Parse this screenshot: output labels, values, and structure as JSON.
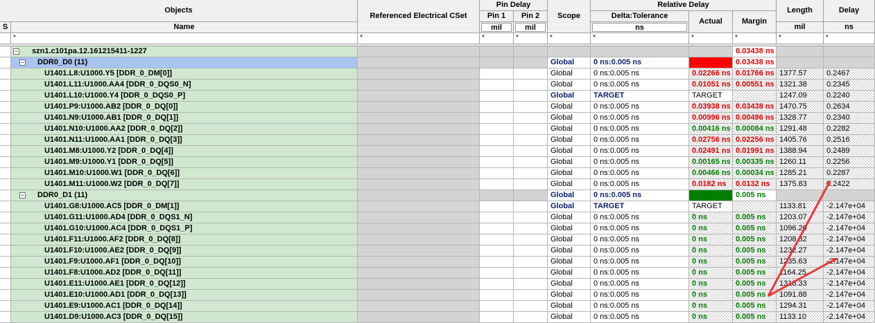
{
  "header": {
    "objects": "Objects",
    "name": "Name",
    "s": "S",
    "ref_cset": "Referenced Electrical CSet",
    "pin_delay": "Pin Delay",
    "pin1": "Pin 1",
    "pin2": "Pin 2",
    "pin_unit": "mil",
    "scope": "Scope",
    "relative_delay": "Relative Delay",
    "delta_tol": "Delta:Tolerance",
    "delta_unit": "ns",
    "actual": "Actual",
    "margin": "Margin",
    "length": "Length",
    "length_unit": "mil",
    "delay": "Delay",
    "delay_unit": "ns",
    "filter": "*"
  },
  "root": {
    "name": "szn1.c101pa.12.161215411-1227",
    "margin": "0.03438 ns",
    "toggle": "−"
  },
  "groups": [
    {
      "name": "DDR0_D0 (11)",
      "scope": "Global",
      "delta": "0 ns:0.005 ns",
      "actual_color": "#ff0000",
      "margin": "0.03438 ns",
      "margin_class": "red",
      "toggle": "−"
    },
    {
      "name": "DDR0_D1 (11)",
      "scope": "Global",
      "delta": "0 ns:0.005 ns",
      "actual_color": "#008000",
      "margin": "0.005 ns",
      "margin_class": "grn",
      "toggle": "−"
    }
  ],
  "rows_d0": [
    {
      "name": "U1401.L8:U1000.Y5 [DDR_0_DM[0]]",
      "scope": "Global",
      "delta": "0 ns:0.005 ns",
      "actual": "0.02266 ns",
      "actual_class": "red",
      "margin": "0.01766 ns",
      "margin_class": "red",
      "length": "1377.57",
      "delay": "0.2467"
    },
    {
      "name": "U1401.L11:U1000.AA4 [DDR_0_DQS0_N]",
      "scope": "Global",
      "delta": "0 ns:0.005 ns",
      "actual": "0.01051 ns",
      "actual_class": "red",
      "margin": "0.00551 ns",
      "margin_class": "red",
      "length": "1321.38",
      "delay": "0.2345"
    },
    {
      "name": "U1401.L10:U1000.Y4 [DDR_0_DQS0_P]",
      "scope": "Global",
      "delta": "TARGET",
      "actual": "TARGET",
      "actual_class": "",
      "margin": "",
      "margin_class": "",
      "length": "1247.09",
      "delay": "0.2240",
      "target": true
    },
    {
      "name": "U1401.P9:U1000.AB2 [DDR_0_DQ[0]]",
      "scope": "Global",
      "delta": "0 ns:0.005 ns",
      "actual": "0.03938 ns",
      "actual_class": "red",
      "margin": "0.03438 ns",
      "margin_class": "red",
      "length": "1470.75",
      "delay": "0.2634"
    },
    {
      "name": "U1401.N9:U1000.AB1 [DDR_0_DQ[1]]",
      "scope": "Global",
      "delta": "0 ns:0.005 ns",
      "actual": "0.00996 ns",
      "actual_class": "red",
      "margin": "0.00496 ns",
      "margin_class": "red",
      "length": "1328.77",
      "delay": "0.2340"
    },
    {
      "name": "U1401.N10:U1000.AA2 [DDR_0_DQ[2]]",
      "scope": "Global",
      "delta": "0 ns:0.005 ns",
      "actual": "0.00416 ns",
      "actual_class": "grn",
      "margin": "0.00084 ns",
      "margin_class": "grn",
      "length": "1291.48",
      "delay": "0.2282"
    },
    {
      "name": "U1401.N11:U1000.AA1 [DDR_0_DQ[3]]",
      "scope": "Global",
      "delta": "0 ns:0.005 ns",
      "actual": "0.02756 ns",
      "actual_class": "red",
      "margin": "0.02256 ns",
      "margin_class": "red",
      "length": "1405.76",
      "delay": "0.2516"
    },
    {
      "name": "U1401.M8:U1000.Y2 [DDR_0_DQ[4]]",
      "scope": "Global",
      "delta": "0 ns:0.005 ns",
      "actual": "0.02491 ns",
      "actual_class": "red",
      "margin": "0.01991 ns",
      "margin_class": "red",
      "length": "1388.94",
      "delay": "0.2489"
    },
    {
      "name": "U1401.M9:U1000.Y1 [DDR_0_DQ[5]]",
      "scope": "Global",
      "delta": "0 ns:0.005 ns",
      "actual": "0.00165 ns",
      "actual_class": "grn",
      "margin": "0.00335 ns",
      "margin_class": "grn",
      "length": "1260.11",
      "delay": "0.2256"
    },
    {
      "name": "U1401.M10:U1000.W1 [DDR_0_DQ[6]]",
      "scope": "Global",
      "delta": "0 ns:0.005 ns",
      "actual": "0.00466 ns",
      "actual_class": "grn",
      "margin": "0.00034 ns",
      "margin_class": "grn",
      "length": "1285.21",
      "delay": "0.2287"
    },
    {
      "name": "U1401.M11:U1000.W2 [DDR_0_DQ[7]]",
      "scope": "Global",
      "delta": "0 ns:0.005 ns",
      "actual": "0.0182 ns",
      "actual_class": "red",
      "margin": "0.0132 ns",
      "margin_class": "red",
      "length": "1375.83",
      "delay": "0.2422"
    }
  ],
  "rows_d1": [
    {
      "name": "U1401.G8:U1000.AC5 [DDR_0_DM[1]]",
      "scope": "Global",
      "delta": "TARGET",
      "actual": "TARGET",
      "actual_class": "",
      "margin": "",
      "margin_class": "",
      "length": "1133.81",
      "delay": "-2.147e+04",
      "target": true
    },
    {
      "name": "U1401.G11:U1000.AD4 [DDR_0_DQS1_N]",
      "scope": "Global",
      "delta": "0 ns:0.005 ns",
      "actual": "0 ns",
      "actual_class": "grn",
      "margin": "0.005 ns",
      "margin_class": "grn",
      "length": "1203.07",
      "delay": "-2.147e+04"
    },
    {
      "name": "U1401.G10:U1000.AC4 [DDR_0_DQS1_P]",
      "scope": "Global",
      "delta": "0 ns:0.005 ns",
      "actual": "0 ns",
      "actual_class": "grn",
      "margin": "0.005 ns",
      "margin_class": "grn",
      "length": "1096.20",
      "delay": "-2.147e+04"
    },
    {
      "name": "U1401.F11:U1000.AF2 [DDR_0_DQ[8]]",
      "scope": "Global",
      "delta": "0 ns:0.005 ns",
      "actual": "0 ns",
      "actual_class": "grn",
      "margin": "0.005 ns",
      "margin_class": "grn",
      "length": "1208.82",
      "delay": "-2.147e+04"
    },
    {
      "name": "U1401.F10:U1000.AE2 [DDR_0_DQ[9]]",
      "scope": "Global",
      "delta": "0 ns:0.005 ns",
      "actual": "0 ns",
      "actual_class": "grn",
      "margin": "0.005 ns",
      "margin_class": "grn",
      "length": "1232.27",
      "delay": "-2.147e+04"
    },
    {
      "name": "U1401.F9:U1000.AF1 [DDR_0_DQ[10]]",
      "scope": "Global",
      "delta": "0 ns:0.005 ns",
      "actual": "0 ns",
      "actual_class": "grn",
      "margin": "0.005 ns",
      "margin_class": "grn",
      "length": "1235.63",
      "delay": "-2.147e+04"
    },
    {
      "name": "U1401.F8:U1000.AD2 [DDR_0_DQ[11]]",
      "scope": "Global",
      "delta": "0 ns:0.005 ns",
      "actual": "0 ns",
      "actual_class": "grn",
      "margin": "0.005 ns",
      "margin_class": "grn",
      "length": "1164.25",
      "delay": "-2.147e+04"
    },
    {
      "name": "U1401.E11:U1000.AE1 [DDR_0_DQ[12]]",
      "scope": "Global",
      "delta": "0 ns:0.005 ns",
      "actual": "0 ns",
      "actual_class": "grn",
      "margin": "0.005 ns",
      "margin_class": "grn",
      "length": "1318.33",
      "delay": "-2.147e+04"
    },
    {
      "name": "U1401.E10:U1000.AD1 [DDR_0_DQ[13]]",
      "scope": "Global",
      "delta": "0 ns:0.005 ns",
      "actual": "0 ns",
      "actual_class": "grn",
      "margin": "0.005 ns",
      "margin_class": "grn",
      "length": "1091.88",
      "delay": "-2.147e+04"
    },
    {
      "name": "U1401.E9:U1000.AC1 [DDR_0_DQ[14]]",
      "scope": "Global",
      "delta": "0 ns:0.005 ns",
      "actual": "0 ns",
      "actual_class": "grn",
      "margin": "0.005 ns",
      "margin_class": "grn",
      "length": "1294.31",
      "delay": "-2.147e+04"
    },
    {
      "name": "U1401.D9:U1000.AC3 [DDR_0_DQ[15]]",
      "scope": "Global",
      "delta": "0 ns:0.005 ns",
      "actual": "0 ns",
      "actual_class": "grn",
      "margin": "0.005 ns",
      "margin_class": "grn",
      "length": "1133.10",
      "delay": "-2.147e+04"
    }
  ],
  "annotation": {
    "arrow_color": "#e83a3a"
  }
}
